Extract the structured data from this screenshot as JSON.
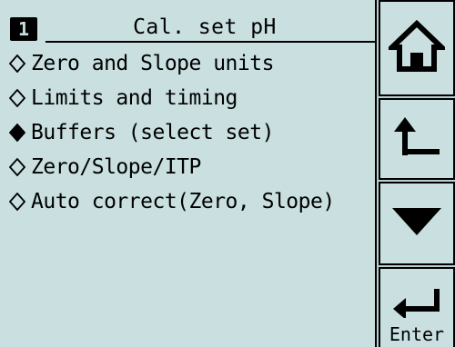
{
  "header": {
    "page_number": "1",
    "title": "Cal. set pH"
  },
  "menu": {
    "items": [
      {
        "label": "Zero and Slope units",
        "selected": false
      },
      {
        "label": "Limits and timing",
        "selected": false
      },
      {
        "label": "Buffers (select set)",
        "selected": true
      },
      {
        "label": "Zero/Slope/ITP",
        "selected": false
      },
      {
        "label": "Auto correct(Zero, Slope)",
        "selected": false
      }
    ]
  },
  "buttons": {
    "home": {
      "icon": "home-icon"
    },
    "back": {
      "icon": "return-up-arrow-icon"
    },
    "down": {
      "icon": "down-triangle-icon"
    },
    "enter": {
      "icon": "enter-arrow-icon",
      "label": "Enter"
    }
  },
  "colors": {
    "screen_bg": "#c9dfe0",
    "ink": "#000000"
  }
}
